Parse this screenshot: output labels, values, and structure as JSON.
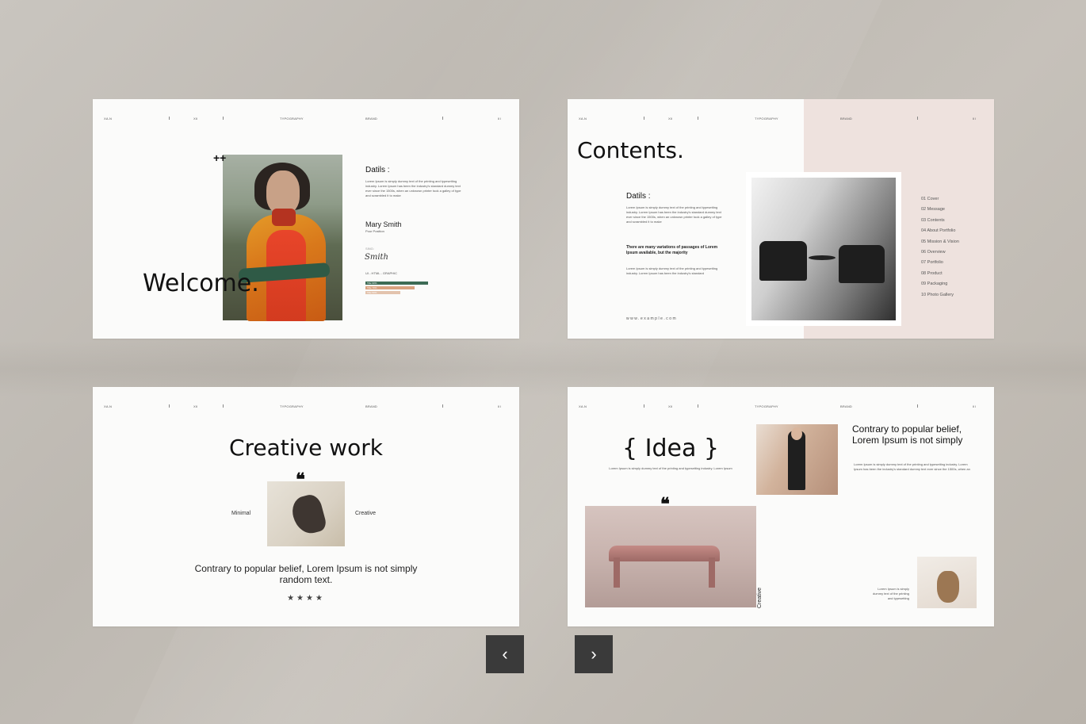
{
  "header": {
    "left": "XA.N",
    "num": "XII",
    "center": "TYPOGRAPHY",
    "brand": "BRAND",
    "right": "III"
  },
  "slide1": {
    "plus": "++",
    "welcome": "Welcome.",
    "details_title": "Datils :",
    "details_text": "Lorem Ipsum is simply dummy text of the printing and typesetting industry. Lorem Ipsum has been the industry's standard dummy text ever since the 1500s, when an unknown printer took a galley of type and scrambled it to make",
    "name": "Mary Smith",
    "position": "Pour Position",
    "sign_label": "SING:",
    "signature": "Smith",
    "skills_label": "UI - HTML - GRAPHIC",
    "bars": [
      {
        "label": "Title 90%",
        "value": 0.9,
        "color": "#3d6b55"
      },
      {
        "label": "Title 70%",
        "value": 0.7,
        "color": "#d9a27f"
      },
      {
        "label": "Title 50%",
        "value": 0.5,
        "color": "#e3c3ad"
      }
    ]
  },
  "slide2": {
    "title": "Contents.",
    "details_title": "Datils :",
    "details_text": "Lorem Ipsum is simply dummy text of the printing and typesetting industry. Lorem Ipsum has been the industry's standard dummy text ever since the 1500s, when an unknown printer took a galley of type and scrambled it to make",
    "bold_text": "There are many variations of passages of Lorem Ipsum available, but the majority",
    "small_text": "Lorem Ipsum is simply dummy text of the printing and typesetting industry. Lorem Ipsum has been the industry's standard",
    "url": "www.example.com",
    "contents": [
      "01 Cover",
      "02 Message",
      "03 Contents",
      "04 About Portfolio",
      "05 Mission & Vision",
      "06 Overview",
      "07 Portfolio",
      "08 Product",
      "09 Packaging",
      "10 Photo Gallery"
    ]
  },
  "slide3": {
    "title": "Creative work",
    "quote_mark": "❝",
    "left_label": "Minimal",
    "right_label": "Creative",
    "statement": "Contrary to popular belief, Lorem Ipsum is not simply random text.",
    "stars": "★★★★"
  },
  "slide4": {
    "title": "{ Idea }",
    "subtitle": "Lorem Ipsum is simply dummy text of the printing and typesetting industry. Lorem Ipsum",
    "heading": "Contrary to popular belief, Lorem Ipsum is not simply",
    "body": "Lorem Ipsum is simply dummy text of the printing and typesetting industry. Lorem Ipsum has been the industry's standard dummy text ever since the 1500s, when an",
    "quote_mark": "❝",
    "vertical_label": "Creative",
    "caption": "Lorem Ipsum is simply dummy text of the printing and typesetting"
  },
  "nav": {
    "prev_icon": "‹",
    "next_icon": "›"
  }
}
